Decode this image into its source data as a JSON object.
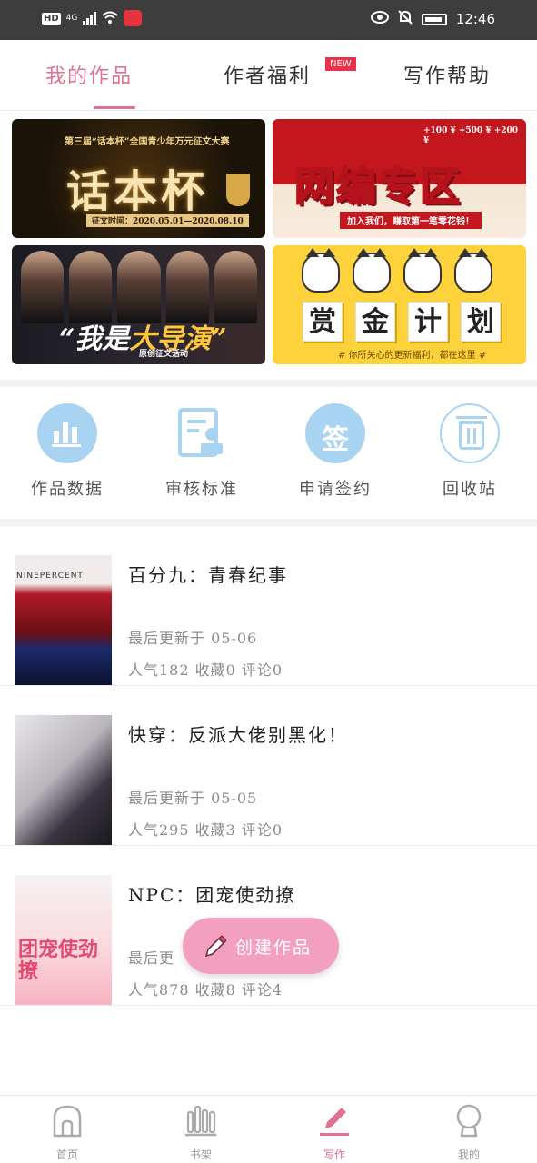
{
  "status_bar": {
    "hd": "HD",
    "network": "4G",
    "time": "12:46"
  },
  "tabs": [
    {
      "label": "我的作品"
    },
    {
      "label": "作者福利",
      "badge": "NEW"
    },
    {
      "label": "写作帮助"
    }
  ],
  "banners": {
    "huaben": {
      "subtitle": "第三届“话本杯”全国青少年万元征文大赛",
      "title": "话本杯",
      "dates": "征文时间：2020.05.01—2020.08.10"
    },
    "wangbian": {
      "title": "网编专区",
      "coins": "+100 ¥ +500 ¥ +200 ¥",
      "slogan": "加入我们，赚取第一笔零花钱！"
    },
    "director": {
      "title_prefix": "“我是",
      "title_main": "大导演”",
      "tag": "原创征文活动"
    },
    "bounty": {
      "chars": [
        "赏",
        "金",
        "计",
        "划"
      ],
      "footer": "# 你所关心的更新福利，都在这里 #"
    }
  },
  "actions": [
    {
      "label": "作品数据",
      "icon": "bar-chart-icon"
    },
    {
      "label": "审核标准",
      "icon": "review-doc-icon"
    },
    {
      "label": "申请签约",
      "icon": "sign-icon"
    },
    {
      "label": "回收站",
      "icon": "trash-icon"
    }
  ],
  "works": [
    {
      "title": "百分九：青春纪事",
      "updated": "最后更新于 05-06",
      "stats": "人气182 收藏0 评论0",
      "cover_text": "NINEPERCENT"
    },
    {
      "title": "快穿：反派大佬别黑化！",
      "updated": "最后更新于 05-05",
      "stats": "人气295 收藏3 评论0",
      "cover_text": ""
    },
    {
      "title": "NPC：团宠使劲撩",
      "updated": "最后更",
      "stats": "人气878 收藏8 评论4",
      "cover_text": "团宠使劲撩"
    }
  ],
  "fab": {
    "label": "创建作品"
  },
  "nav": [
    {
      "label": "首页"
    },
    {
      "label": "书架"
    },
    {
      "label": "写作"
    },
    {
      "label": "我的"
    }
  ],
  "colors": {
    "accent": "#e0718f",
    "icon_blue": "#a8d4f2",
    "fab_pink": "#f29fc0"
  }
}
